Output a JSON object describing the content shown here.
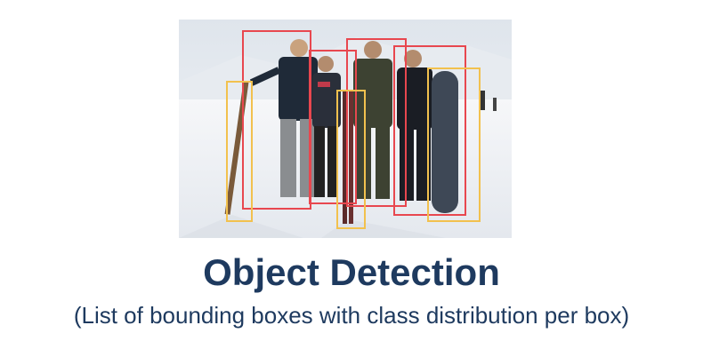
{
  "title": "Object Detection",
  "subtitle": "(List of bounding boxes with class distribution per box)",
  "colors": {
    "person_box": "#e8474f",
    "skis_box": "#f2c14e",
    "text": "#1e3a5f"
  }
}
